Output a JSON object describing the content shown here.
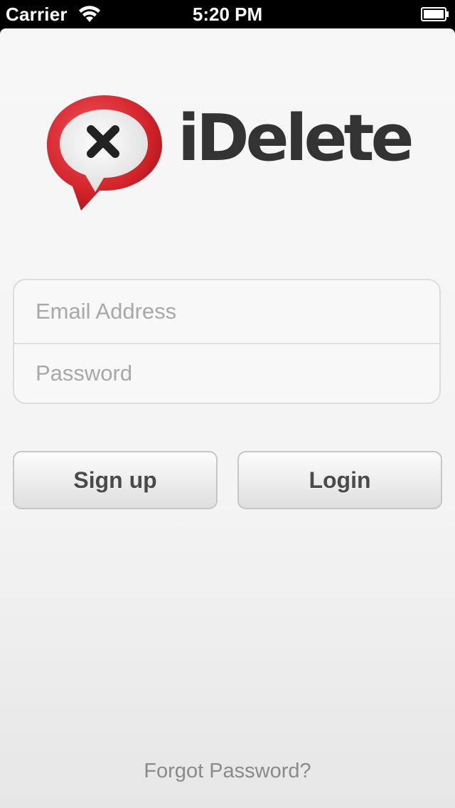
{
  "status_bar": {
    "carrier": "Carrier",
    "time": "5:20 PM",
    "wifi_icon": "wifi-icon",
    "battery_icon": "battery-icon"
  },
  "logo": {
    "text": "iDelete",
    "icon": "speech-bubble-x-icon",
    "accent_color": "#d2232a"
  },
  "form": {
    "email_placeholder": "Email Address",
    "email_value": "",
    "password_placeholder": "Password",
    "password_value": ""
  },
  "buttons": {
    "signup_label": "Sign up",
    "login_label": "Login"
  },
  "footer": {
    "forgot_password": "Forgot Password?"
  }
}
